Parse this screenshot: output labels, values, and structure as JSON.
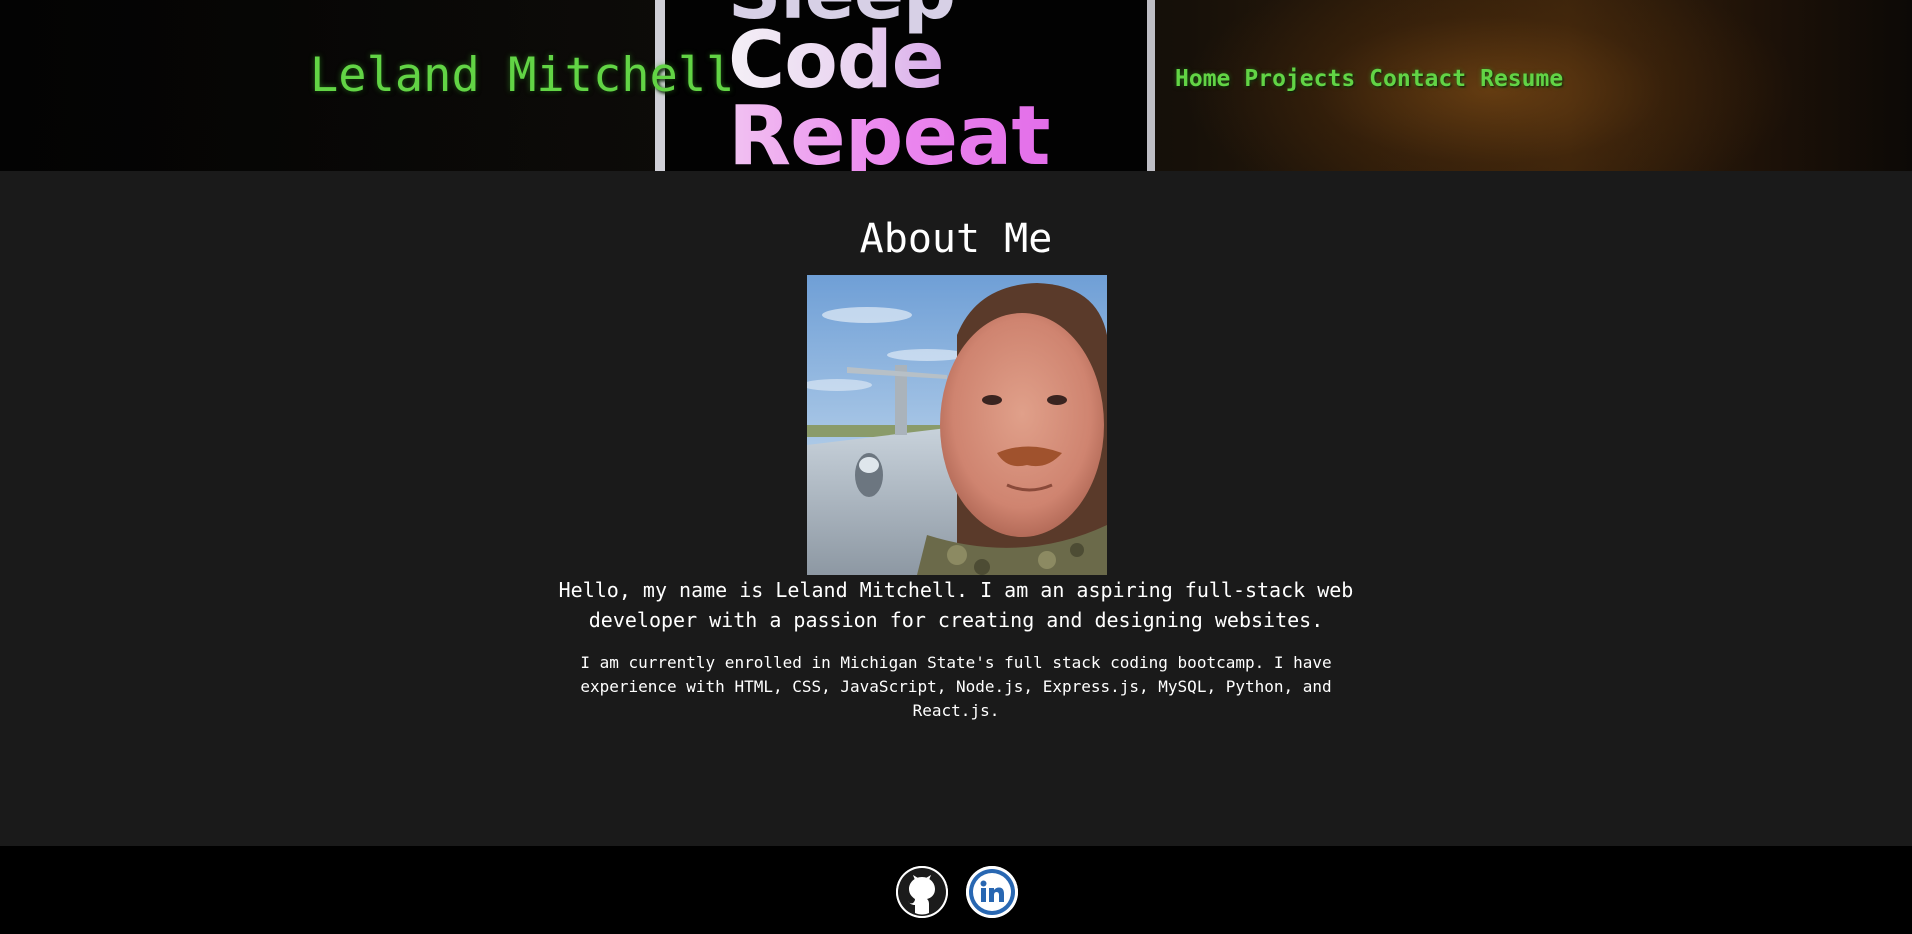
{
  "header": {
    "site_title": "Leland Mitchell",
    "background_image": {
      "line_1": "Sleep",
      "line_2": "Code",
      "line_3": "Repeat"
    },
    "nav": [
      {
        "label": "Home"
      },
      {
        "label": "Projects"
      },
      {
        "label": "Contact"
      },
      {
        "label": "Resume"
      }
    ]
  },
  "about": {
    "heading": "About Me",
    "intro": "Hello, my name is Leland Mitchell. I am an aspiring full-stack web developer with a passion for creating and designing websites.",
    "details": "I am currently enrolled in Michigan State's full stack coding bootcamp. I have experience with HTML, CSS, JavaScript, Node.js, Express.js, MySQL, Python, and React.js."
  },
  "footer": {
    "social": [
      {
        "icon": "github-icon"
      },
      {
        "icon": "linkedin-icon"
      }
    ]
  },
  "colors": {
    "accent_green": "#62d445",
    "main_background": "#1a1a1a",
    "footer_background": "#000000",
    "linkedin_blue": "#2867b2"
  }
}
